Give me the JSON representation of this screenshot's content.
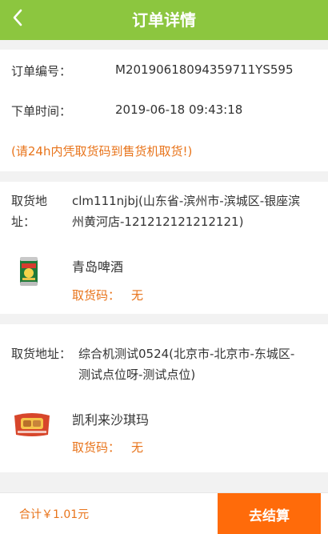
{
  "header": {
    "title": "订单详情",
    "back_icon": "chevron-left-icon"
  },
  "order": {
    "number_label": "订单编号：",
    "number_value": "M20190618094359711YS595",
    "time_label": "下单时间：",
    "time_value": "2019-06-18 09:43:18",
    "notice": "(请24h内凭取货码到售货机取货!)"
  },
  "items": [
    {
      "address_label_line1": "取货地",
      "address_label_line2": "址：",
      "address_line1": "clm111njbj(山东省-滨州市-滨城区-银座滨",
      "address_line2": "州黄河店-121212121212121)",
      "product_name": "青岛啤酒",
      "pickup_label": "取货码：",
      "pickup_code": "无",
      "image_icon": "beer-can-icon"
    },
    {
      "address_label": "取货地址：",
      "address_line1": "综合机测试0524(北京市-北京市-东城区-",
      "address_line2": "测试点位呀-测试点位)",
      "product_name": "凯利来沙琪玛",
      "pickup_label": "取货码：",
      "pickup_code": "无",
      "image_icon": "snack-pack-icon"
    }
  ],
  "footer": {
    "total": "合计￥1.01元",
    "checkout_label": "去结算"
  },
  "colors": {
    "header": "#8cc63f",
    "accent": "#e8741b",
    "button": "#ff6b0a"
  }
}
